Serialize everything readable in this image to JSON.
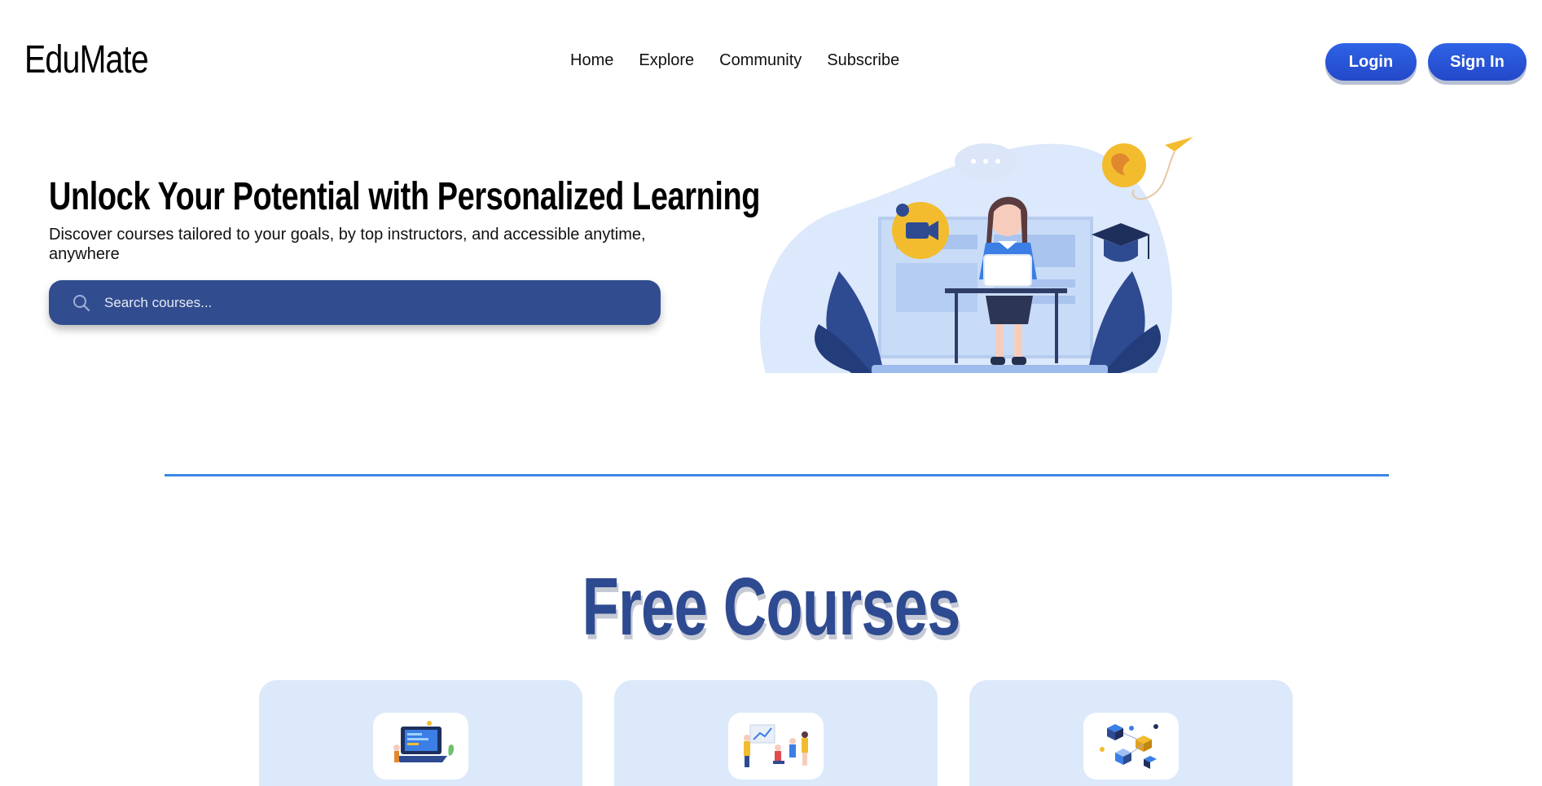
{
  "header": {
    "logo": "EduMate",
    "nav": [
      "Home",
      "Explore",
      "Community",
      "Subscribe"
    ],
    "login_label": "Login",
    "signin_label": "Sign In"
  },
  "hero": {
    "title": "Unlock Your Potential with Personalized Learning",
    "subtitle": "Discover courses tailored to your goals, by top instructors, and accessible anytime, anywhere",
    "search_placeholder": "Search courses...",
    "illustration_icon": "student-laptop-illustration"
  },
  "section": {
    "title": "Free Courses"
  },
  "cards": [
    {
      "thumb_icon": "coding-laptop-illustration"
    },
    {
      "thumb_icon": "presentation-team-illustration"
    },
    {
      "thumb_icon": "isometric-network-illustration"
    }
  ],
  "colors": {
    "accent": "#2348c9",
    "search_bg": "#324d8f",
    "divider": "#3b86e6",
    "card_bg": "#dce9fb",
    "section_title": "#2e4a91"
  }
}
